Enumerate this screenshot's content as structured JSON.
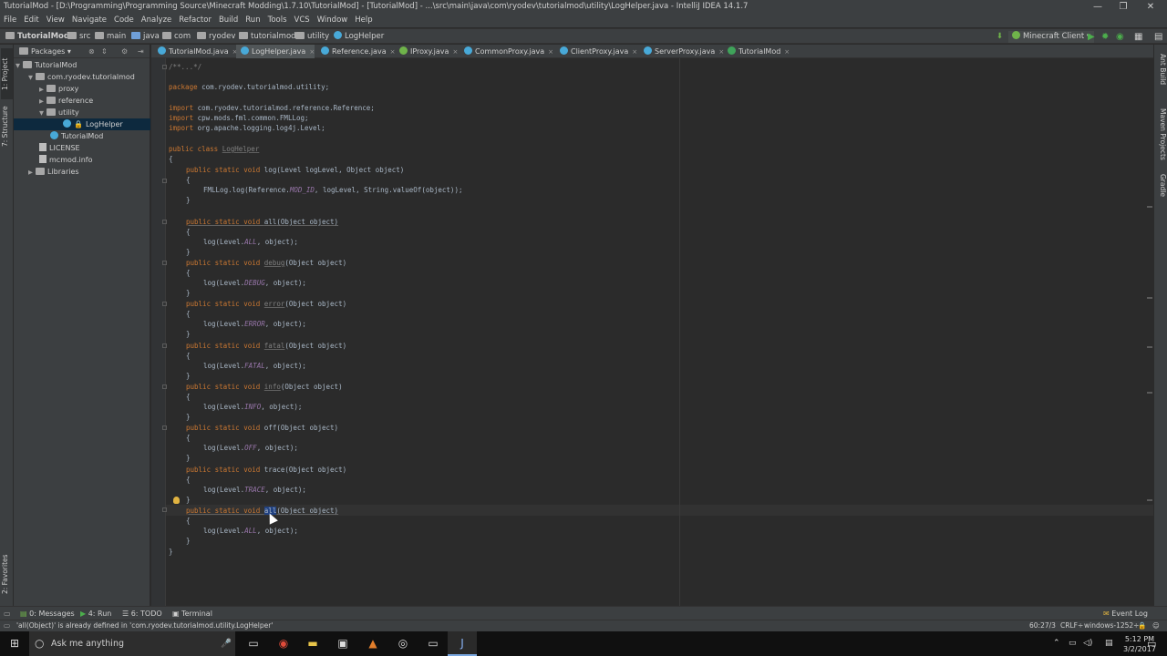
{
  "window": {
    "title": "TutorialMod - [D:\\Programming\\Programming Source\\Minecraft Modding\\1.7.10\\TutorialMod] - [TutorialMod] - ...\\src\\main\\java\\com\\ryodev\\tutorialmod\\utility\\LogHelper.java - IntelliJ IDEA 14.1.7",
    "minimize": "—",
    "restore": "❐",
    "close": "✕"
  },
  "menu": [
    "File",
    "Edit",
    "View",
    "Navigate",
    "Code",
    "Analyze",
    "Refactor",
    "Build",
    "Run",
    "Tools",
    "VCS",
    "Window",
    "Help"
  ],
  "breadcrumb": [
    "TutorialMod",
    "src",
    "main",
    "java",
    "com",
    "ryodev",
    "tutorialmod",
    "utility",
    "LogHelper"
  ],
  "run_config": "Minecraft Client",
  "project_panel": {
    "header": "Packages",
    "tree": [
      "TutorialMod",
      "com.ryodev.tutorialmod",
      "proxy",
      "reference",
      "utility",
      "LogHelper",
      "TutorialMod",
      "LICENSE",
      "mcmod.info",
      "Libraries"
    ]
  },
  "side_tabs": {
    "left": [
      "1: Project",
      "7: Structure",
      "2: Favorites"
    ],
    "right": [
      "Ant Build",
      "Maven Projects",
      "Gradle"
    ]
  },
  "tabs": [
    "TutorialMod.java",
    "LogHelper.java",
    "Reference.java",
    "IProxy.java",
    "CommonProxy.java",
    "ClientProxy.java",
    "ServerProxy.java",
    "TutorialMod"
  ],
  "code": {
    "header_comment": "/**...*/",
    "package_kw": "package",
    "package_name": " com.ryodev.tutorialmod.utility;",
    "import_kw": "import",
    "import1": " com.ryodev.tutorialmod.reference.Reference;",
    "import2": " cpw.mods.fml.common.FMLLog;",
    "import3": " org.apache.logging.log4j.Level;",
    "public_class": "public class ",
    "class_name": "LogHelper",
    "open_brace": "{",
    "close_brace": "}",
    "method_kw": "public static void ",
    "log_sig": "log(Level logLevel, Object object)",
    "fml_pre": "FMLLog.log(Reference.",
    "mod_id": "MOD_ID",
    "fml_post": ", logLevel, String.valueOf(object));",
    "param": "(Object object)",
    "call_pre": "log(Level.",
    "call_post": ", object);",
    "methods": [
      {
        "name": "all",
        "level": "ALL"
      },
      {
        "name": "debug",
        "level": "DEBUG"
      },
      {
        "name": "error",
        "level": "ERROR"
      },
      {
        "name": "fatal",
        "level": "FATAL"
      },
      {
        "name": "info",
        "level": "INFO"
      },
      {
        "name": "off",
        "level": "OFF"
      },
      {
        "name": "trace",
        "level": "TRACE"
      },
      {
        "name": "all",
        "level": "ALL"
      }
    ]
  },
  "bottom_tools": [
    "0: Messages",
    "4: Run",
    "6: TODO",
    "Terminal",
    "Event Log"
  ],
  "status": {
    "message": "'all(Object)' is already defined in 'com.ryodev.tutorialmod.utility.LogHelper'",
    "position": "60:27/3",
    "line_sep": "CRLF÷",
    "encoding": "windows-1252÷"
  },
  "taskbar": {
    "search": "Ask me anything",
    "time": "5:12 PM",
    "date": "3/2/2017"
  }
}
